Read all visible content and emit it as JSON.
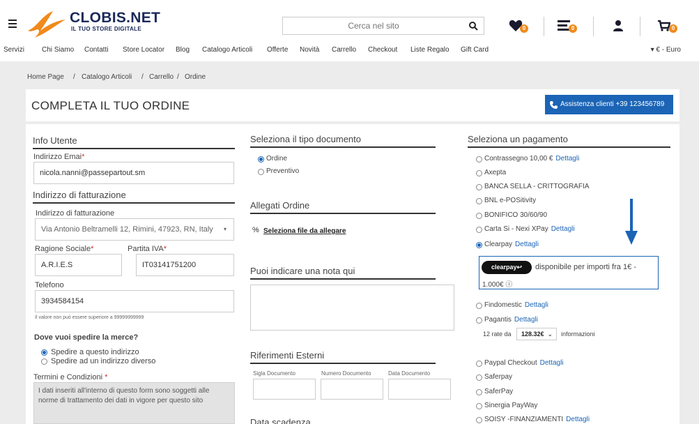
{
  "header": {
    "logo_name": "CLOBIS.NET",
    "logo_tagline": "IL TUO STORE DIGITALE",
    "search_placeholder": "Cerca nel sito",
    "wishlist_count": "0",
    "compare_count": "0",
    "cart_count": "0"
  },
  "nav": {
    "items": [
      "Servizi",
      "Chi Siamo",
      "Contatti",
      "Store Locator",
      "Blog",
      "Catalogo Articoli",
      "Offerte",
      "Novità",
      "Carrello",
      "Checkout",
      "Liste Regalo",
      "Gift Card"
    ],
    "currency": "▾ € - Euro"
  },
  "breadcrumb": [
    "Home Page",
    "/",
    "Catalogo Articoli",
    "/",
    "Carrello",
    "/",
    "Ordine"
  ],
  "page": {
    "title": "COMPLETA IL TUO ORDINE",
    "assist_button": "Assistenza clienti +39 123456789"
  },
  "user": {
    "section_title": "Info Utente",
    "email_label": "Indirizzo Emai",
    "email_value": "nicola.nanni@passepartout.sm",
    "billing_title": "Indirizzo di fatturazione",
    "billing_label": "Indirizzo di fatturazione",
    "billing_value": "Via Antonio Beltramelli 12, Rimini, 47923, RN, Italy",
    "ragione_label": "Ragione Sociale",
    "ragione_value": "A.R.I.E.S",
    "piva_label": "Partita IVA",
    "piva_value": "IT03141751200",
    "phone_label": "Telefono",
    "phone_value": "3934584154",
    "phone_hint": "Il valore non può essere superiore a 99999999999",
    "ship_question": "Dove vuoi spedire la merce?",
    "ship_options": [
      "Spedire a questo indirizzo",
      "Spedire ad un indirizzo diverso"
    ],
    "terms_label": "Termini e Condizioni",
    "terms_text": "I dati inseriti all'interno di questo form sono soggetti alle norme di trattamento dei dati in vigore per questo sito"
  },
  "document": {
    "title": "Seleziona il tipo documento",
    "options": [
      "Ordine",
      "Preventivo"
    ],
    "attach_title": "Allegati Ordine",
    "attach_link": "Seleziona file da allegare",
    "note_title": "Puoi indicare una nota qui",
    "refs_title": "Riferimenti Esterni",
    "ref_labels": [
      "Sigla Documento",
      "Numero Documento",
      "Data Documento"
    ],
    "due_title": "Data scadenza"
  },
  "payment": {
    "title": "Seleziona un pagamento",
    "details_label": "Dettagli",
    "methods": [
      "Contrassegno 10,00 €",
      "Axepta",
      "BANCA SELLA - CRITTOGRAFIA",
      "BNL e-POSitivity",
      "BONIFICO 30/60/90",
      "Carta Si - Nexi XPay",
      "Clearpay"
    ],
    "clearpay_pill": "clearpay↩",
    "clearpay_text_1": "disponibile per importi fra 1€ -",
    "clearpay_text_2": "1.000€ ⓘ",
    "more_methods": [
      "Findomestic",
      "Pagantis"
    ],
    "rate_prefix": "12 rate da",
    "rate_value": "128.32€",
    "rate_suffix": "informazioni",
    "bottom_methods": [
      "Paypal Checkout",
      "Saferpay",
      "SaferPay",
      "Sinergia PayWay",
      "SOISY -FINANZIAMENTI"
    ]
  },
  "colors": {
    "accent": "#1b64b6",
    "badge": "#f08a1c"
  }
}
